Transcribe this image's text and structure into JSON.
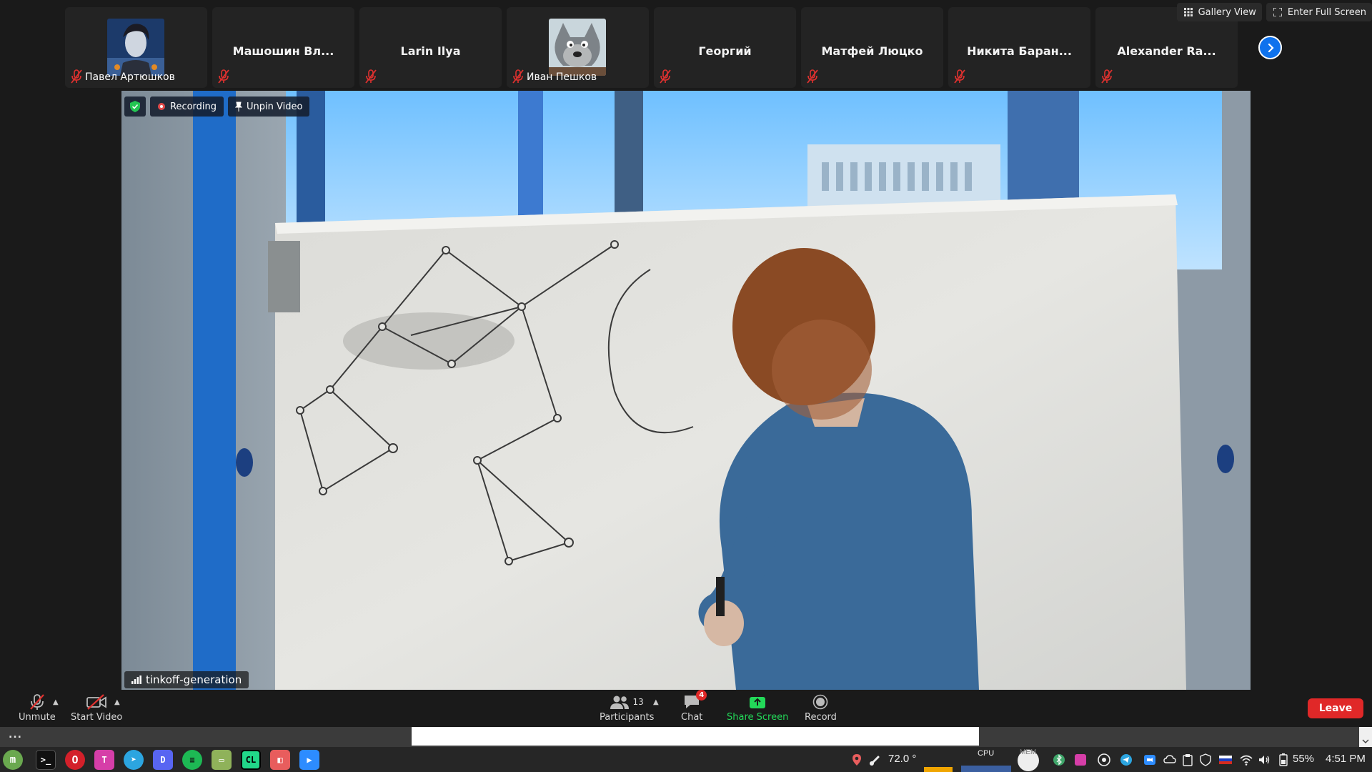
{
  "participants": [
    {
      "name": "Павел Артюшков",
      "muted": true,
      "has_avatar": true
    },
    {
      "name": "Машошин Вл...",
      "muted": true,
      "has_avatar": false
    },
    {
      "name": "Larin Ilya",
      "muted": true,
      "has_avatar": false
    },
    {
      "name": "Иван Пешков",
      "muted": true,
      "has_avatar": true
    },
    {
      "name": "Георгий",
      "muted": true,
      "has_avatar": false
    },
    {
      "name": "Матфей Люцко",
      "muted": true,
      "has_avatar": false
    },
    {
      "name": "Никита Баран...",
      "muted": true,
      "has_avatar": false
    },
    {
      "name": "Alexander Ra...",
      "muted": true,
      "has_avatar": false
    }
  ],
  "view_controls": {
    "gallery": "Gallery View",
    "fullscreen": "Enter Full Screen"
  },
  "video": {
    "recording_label": "Recording",
    "unpin_label": "Unpin Video",
    "meeting_name": "tinkoff-generation"
  },
  "controls": {
    "unmute": "Unmute",
    "start_video": "Start Video",
    "participants": "Participants",
    "participants_count": "13",
    "chat": "Chat",
    "chat_badge": "4",
    "share": "Share Screen",
    "record": "Record",
    "leave": "Leave"
  },
  "dock": {
    "dots": "..."
  },
  "taskbar": {
    "temperature": "72.0 °",
    "cpu_label": "CPU",
    "mem_label": "MEM",
    "battery": "55%",
    "time": "4:51 PM"
  },
  "colors": {
    "accent_blue": "#0e72ed",
    "leave_red": "#e02828",
    "share_green": "#23d959"
  }
}
